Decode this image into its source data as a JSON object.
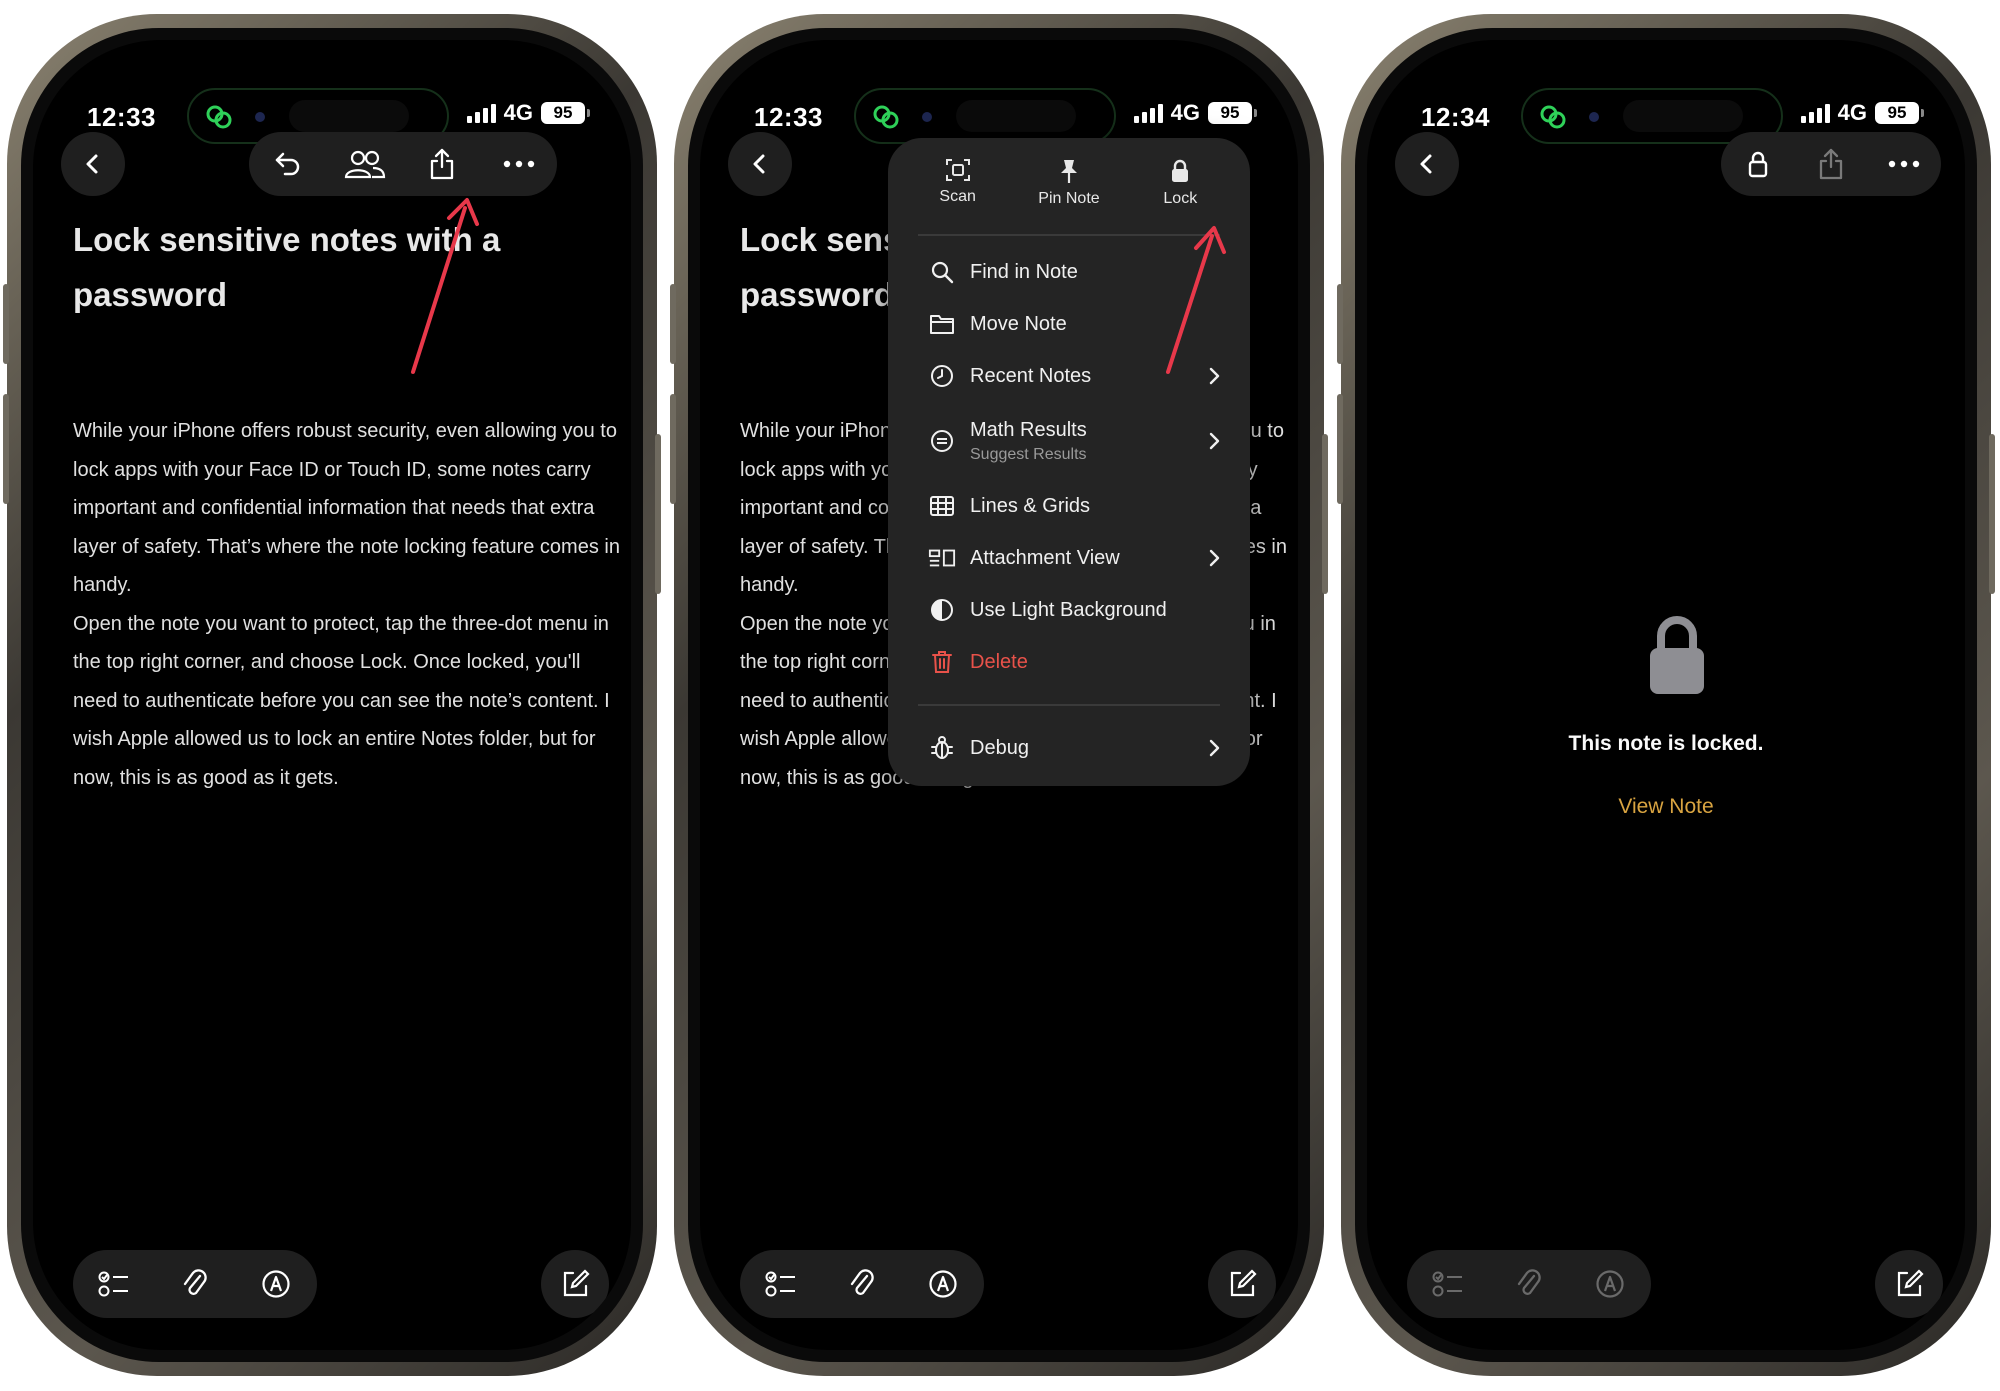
{
  "colors": {
    "accent_link": "#d9a441",
    "delete_red": "#e8524a",
    "arrow_red": "#e8384a",
    "island_green": "#2fd159"
  },
  "phones": [
    {
      "status": {
        "time": "12:33",
        "network": "4G",
        "battery": "95"
      },
      "note": {
        "title": "Lock sensitive notes with a password",
        "body": "While your iPhone offers robust security, even allowing you to lock apps with your Face ID or Touch ID, some notes carry important and confidential information that needs that extra layer of safety. That’s where the note locking feature comes in handy.\nOpen the note you want to protect, tap the three-dot menu in the top right corner, and choose Lock. Once locked, you'll need to authenticate before you can see the note’s content. I wish Apple allowed us to lock an entire Notes folder, but for now, this is as good as it gets."
      },
      "toolbar_icons": [
        "undo-icon",
        "collaborate-icon",
        "share-icon",
        "more-icon"
      ],
      "bottom_icons": [
        "checklist-icon",
        "attachment-icon",
        "markup-icon",
        "compose-icon"
      ]
    },
    {
      "status": {
        "time": "12:33",
        "network": "4G",
        "battery": "95"
      },
      "note": {
        "title": "Lock sensitive notes with a password",
        "body": "While your iPhone offers robust security, even allowing you to lock apps with your Face ID or Touch ID, some notes carry important and confidential information that needs that extra layer of safety. That’s where the note locking feature comes in handy.\nOpen the note you want to protect, tap the three-dot menu in the top right corner, and choose Lock. Once locked, you'll need to authenticate before you can see the note’s content. I wish Apple allowed us to lock an entire Notes folder, but for now, this is as good as it gets."
      },
      "menu": {
        "quick_actions": [
          {
            "label": "Scan",
            "icon": "scan-icon"
          },
          {
            "label": "Pin Note",
            "icon": "pin-icon"
          },
          {
            "label": "Lock",
            "icon": "lock-icon"
          }
        ],
        "items": [
          {
            "label": "Find in Note",
            "icon": "magnifier-icon",
            "chevron": false
          },
          {
            "label": "Move Note",
            "icon": "folder-icon",
            "chevron": false
          },
          {
            "label": "Recent Notes",
            "icon": "clock-icon",
            "chevron": true
          },
          {
            "label": "Math Results",
            "sublabel": "Suggest Results",
            "icon": "equals-icon",
            "chevron": true
          },
          {
            "label": "Lines & Grids",
            "icon": "grid-icon",
            "chevron": false
          },
          {
            "label": "Attachment View",
            "icon": "attachment-view-icon",
            "chevron": true
          },
          {
            "label": "Use Light Background",
            "icon": "contrast-icon",
            "chevron": false
          },
          {
            "label": "Delete",
            "icon": "trash-icon",
            "chevron": false
          }
        ],
        "debug": {
          "label": "Debug",
          "icon": "bug-icon",
          "chevron": true
        }
      }
    },
    {
      "status": {
        "time": "12:34",
        "network": "4G",
        "battery": "95"
      },
      "locked": {
        "message": "This note is locked.",
        "action": "View Note"
      },
      "toolbar_icons": [
        "lock-icon",
        "share-icon",
        "more-icon"
      ]
    }
  ]
}
